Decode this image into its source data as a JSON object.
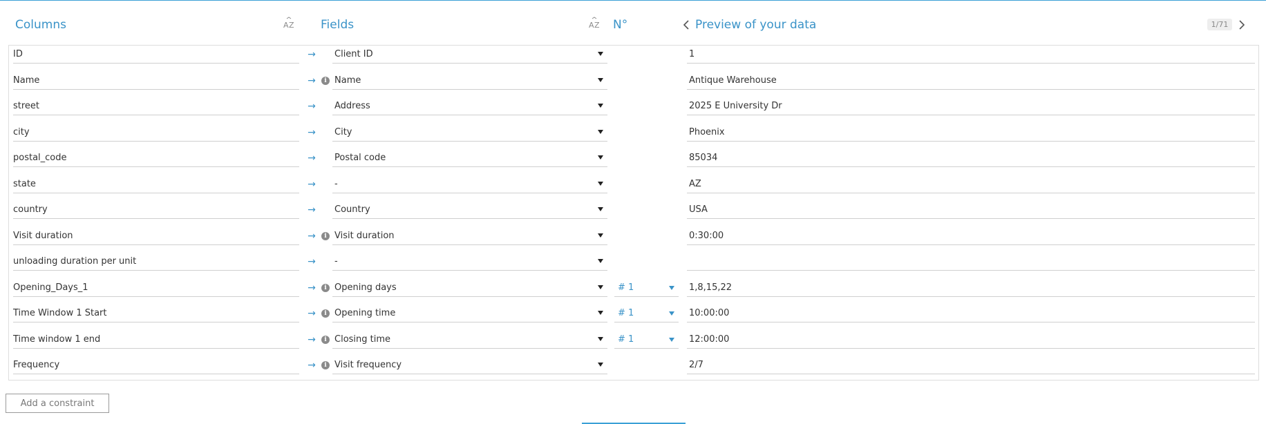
{
  "headers": {
    "columns": "Columns",
    "fields": "Fields",
    "number": "N°",
    "preview": "Preview of your data",
    "page": "1/71"
  },
  "rows": [
    {
      "column": "ID",
      "info": false,
      "field": "Client ID",
      "num": "",
      "preview": "1"
    },
    {
      "column": "Name",
      "info": true,
      "field": "Name",
      "num": "",
      "preview": "Antique Warehouse"
    },
    {
      "column": "street",
      "info": false,
      "field": "Address",
      "num": "",
      "preview": "2025 E University Dr"
    },
    {
      "column": "city",
      "info": false,
      "field": "City",
      "num": "",
      "preview": "Phoenix"
    },
    {
      "column": "postal_code",
      "info": false,
      "field": "Postal code",
      "num": "",
      "preview": "85034"
    },
    {
      "column": "state",
      "info": false,
      "field": "-",
      "num": "",
      "preview": "AZ"
    },
    {
      "column": "country",
      "info": false,
      "field": "Country",
      "num": "",
      "preview": "USA"
    },
    {
      "column": "Visit duration",
      "info": true,
      "field": "Visit duration",
      "num": "",
      "preview": "0:30:00"
    },
    {
      "column": "unloading duration per unit",
      "info": false,
      "field": "-",
      "num": "",
      "preview": ""
    },
    {
      "column": "Opening_Days_1",
      "info": true,
      "field": "Opening days",
      "num": "# 1",
      "preview": "1,8,15,22"
    },
    {
      "column": "Time Window 1 Start",
      "info": true,
      "field": "Opening time",
      "num": "# 1",
      "preview": "10:00:00"
    },
    {
      "column": "Time window 1 end",
      "info": true,
      "field": "Closing time",
      "num": "# 1",
      "preview": "12:00:00"
    },
    {
      "column": "Frequency",
      "info": true,
      "field": "Visit frequency",
      "num": "",
      "preview": "2/7"
    }
  ],
  "actions": {
    "add_constraint": "Add a constraint"
  },
  "icons": {
    "arrow": "→",
    "info": "i",
    "sort": "sort-az-icon",
    "prev": "chevron-left-icon",
    "next": "chevron-right-icon"
  },
  "colors": {
    "accent": "#3a93c8",
    "border": "#cfcfcf"
  }
}
